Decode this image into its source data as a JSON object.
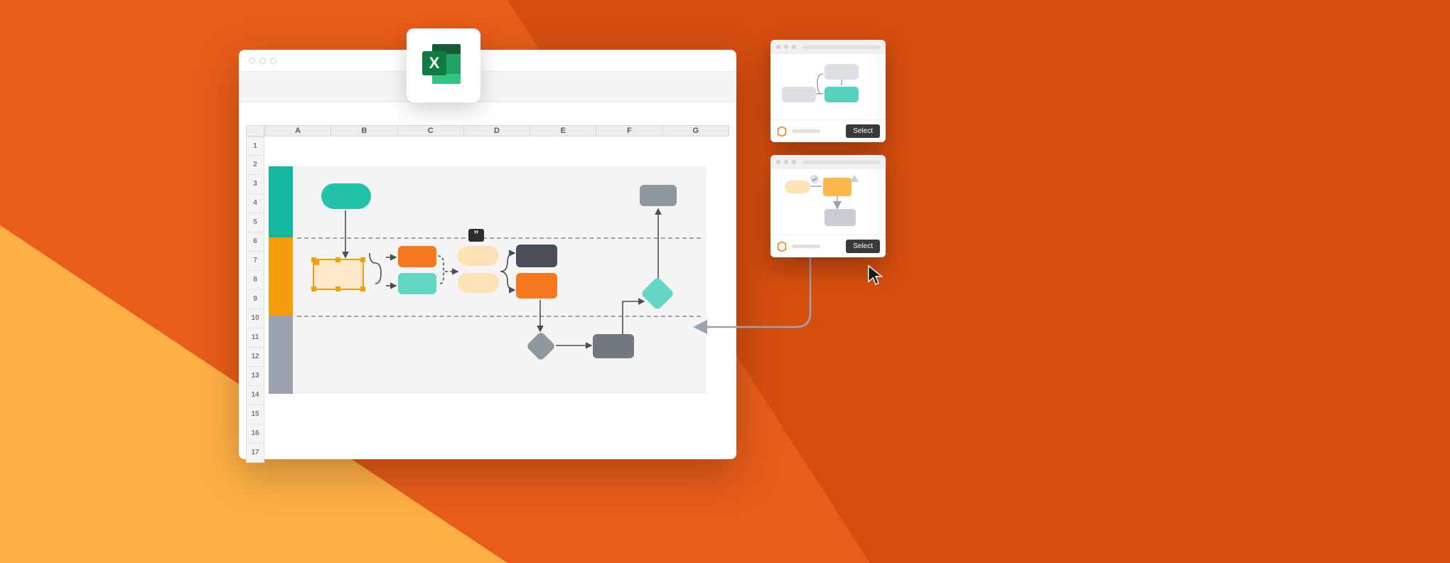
{
  "sheet": {
    "columns": [
      "A",
      "B",
      "C",
      "D",
      "E",
      "F",
      "G"
    ],
    "rows": [
      "1",
      "2",
      "3",
      "4",
      "5",
      "6",
      "7",
      "8",
      "9",
      "10",
      "11",
      "12",
      "13",
      "14",
      "15",
      "16",
      "17"
    ]
  },
  "excel_badge": {
    "letter": "X"
  },
  "comment_glyph": "”",
  "templates": {
    "card1": {
      "button": "Select"
    },
    "card2": {
      "button": "Select"
    }
  },
  "colors": {
    "teal": "#22c1a9",
    "teal_dark": "#15b79f",
    "mint": "#63d6c4",
    "orange": "#f4791f",
    "amber": "#f59e0b",
    "cream": "#fde2b5",
    "gray": "#8f97a1",
    "gray_dark": "#4a4f57",
    "gray_light": "#c9ced5"
  }
}
